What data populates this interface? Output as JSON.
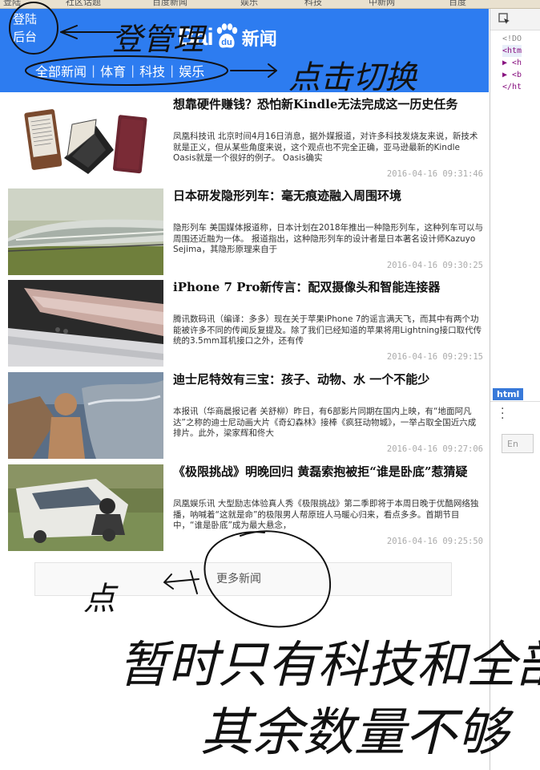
{
  "browser": {
    "tabs": [
      "登陆",
      "社区话题",
      "百度新闻",
      "娱乐",
      "科技",
      "中新网",
      "百度"
    ]
  },
  "header": {
    "login_label": "登陆",
    "admin_label": "后台",
    "logo_text": "Bai",
    "logo_text_2": "du",
    "logo_news": "新闻",
    "nav": [
      "全部新闻",
      "体育",
      "科技",
      "娱乐"
    ]
  },
  "news": [
    {
      "title": "想靠硬件赚钱？恐怕新Kindle无法完成这一历史任务",
      "summary": "凤凰科技讯 北京时间4月16日消息，据外媒报道，对许多科技发烧友来说，新技术就是正义，但从某些角度来说，这个观点也不完全正确，亚马逊最新的Kindle Oasis就是一个很好的例子。 Oasis确实",
      "time": "2016-04-16 09:31:46"
    },
    {
      "title": "日本研发隐形列车：毫无痕迹融入周围环境",
      "summary": "隐形列车 美国媒体报道称，日本计划在2018年推出一种隐形列车，这种列车可以与周围还近融为一体。 报道指出，这种隐形列车的设计者是日本著名设计师Kazuyo Sejima，其隐形原理来自于",
      "time": "2016-04-16 09:30:25"
    },
    {
      "title": "iPhone 7 Pro新传言：配双摄像头和智能连接器",
      "summary": "腾讯数码讯（编译：多多）现在关于苹果iPhone 7的谣言满天飞，而其中有两个功能被许多不同的传闻反复提及。除了我们已经知道的苹果将用Lightning接口取代传统的3.5mm耳机接口之外，还有传",
      "time": "2016-04-16 09:29:15"
    },
    {
      "title": "迪士尼特效有三宝：孩子、动物、水 一个不能少",
      "summary": "本报讯（华商晨报记者 关舒柳）昨日，有6部影片同期在国内上映，有“地面阿凡达”之称的迪士尼动画大片《奇幻森林》接棒《疯狂动物城》，一举占取全国近六成排片。此外，梁家辉和佟大",
      "time": "2016-04-16 09:27:06"
    },
    {
      "title": "《极限挑战》明晚回归 黄磊索抱被拒“谁是卧底”惹猜疑",
      "summary": "凤凰娱乐讯 大型励志体验真人秀《极限挑战》第二季即将于本周日晚于优酷网络独播，呐喊着“这就是命”的极限男人帮原班人马暖心归来，看点多多。首期节目中，“谁是卧底”成为最大悬念，",
      "time": "2016-04-16 09:25:50"
    }
  ],
  "more_label": "更多新闻",
  "devtools": {
    "lines": [
      "<!DO",
      "<htm",
      "▶ <h",
      "▶ <b",
      "</ht"
    ],
    "crumb": "html",
    "input_placeholder": "En"
  },
  "annotations": {
    "login_note": "登管理",
    "nav_note": "点击切换",
    "more_note": "点",
    "note_line_1": "暂时只有科技和全部",
    "note_line_2": "其余数量不够"
  },
  "colors": {
    "header_bg": "#2d7cf0",
    "ink": "#111111"
  }
}
